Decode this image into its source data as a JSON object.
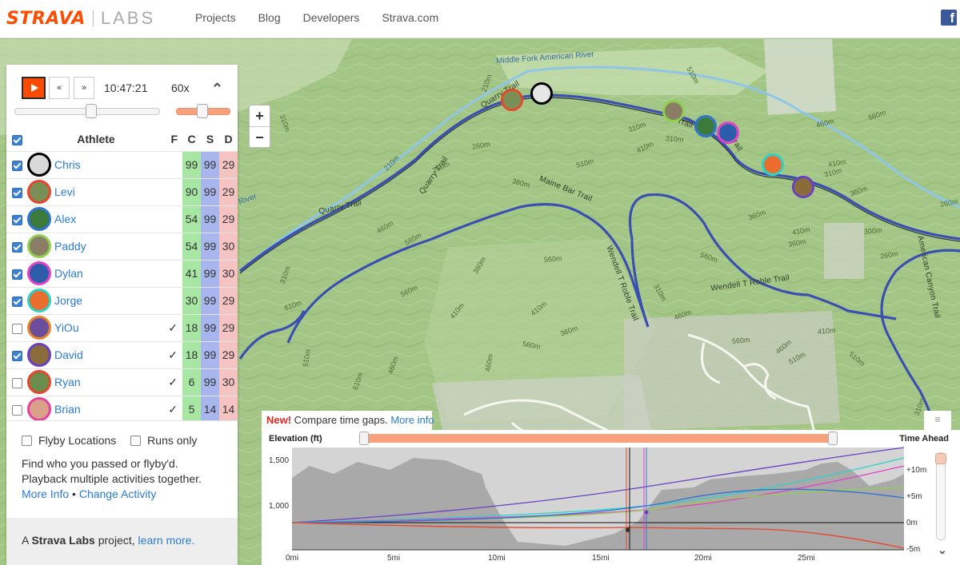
{
  "header": {
    "logo_main": "STRAVA",
    "logo_sub": "LABS",
    "nav": [
      "Projects",
      "Blog",
      "Developers",
      "Strava.com"
    ],
    "facebook_icon": "facebook-icon"
  },
  "map": {
    "zoom_in": "+",
    "zoom_out": "−",
    "labels": {
      "river_top": "Middle Fork American River",
      "river_left": "River",
      "quarry_top": "Quarry Trail",
      "quarry_side": "Quarry Trail",
      "quarry_mid": "Quarry Trail",
      "maine_bar": "Maine Bar Trail",
      "wendell_vert": "Wendell T Roble Trail",
      "wendell_horiz": "Wendell T Roble Trail",
      "american_canyon": "American Canyon Trail",
      "trail_frag_1": "Trail",
      "trail_frag_2": "Trail"
    },
    "contours": [
      "210m",
      "210m",
      "310m",
      "260m",
      "360m",
      "260m",
      "310m",
      "410m",
      "310m",
      "510m",
      "460m",
      "410m",
      "360m",
      "310m",
      "300m",
      "260m",
      "410m",
      "560m",
      "510m",
      "460m",
      "560m",
      "360m",
      "410m",
      "310m",
      "510m",
      "610m",
      "460m",
      "610m",
      "560m",
      "410m",
      "360m",
      "460m",
      "310m",
      "560m",
      "460m",
      "360m",
      "410m",
      "510m",
      "510m",
      "560m",
      "460m",
      "360m",
      "560m",
      "560m",
      "310m",
      "260m"
    ]
  },
  "controls": {
    "play_icon": "play-icon",
    "rewind_label": "«",
    "forward_label": "»",
    "time": "10:47:21",
    "speed": "60x",
    "collapse_icon": "chevron-up-icon"
  },
  "table": {
    "headers": {
      "athlete": "Athlete",
      "f": "F",
      "c": "C",
      "s": "S",
      "d": "D"
    },
    "rows": [
      {
        "name": "Chris",
        "checked": true,
        "f": "",
        "c": "99",
        "s": "99",
        "d": "29",
        "ring": "#000000",
        "fill": "#d9d9d9"
      },
      {
        "name": "Levi",
        "checked": true,
        "f": "",
        "c": "90",
        "s": "99",
        "d": "29",
        "ring": "#e8452b",
        "fill": "#7a8f55"
      },
      {
        "name": "Alex",
        "checked": true,
        "f": "",
        "c": "54",
        "s": "99",
        "d": "29",
        "ring": "#2f74d0",
        "fill": "#3b7a3a"
      },
      {
        "name": "Paddy",
        "checked": true,
        "f": "",
        "c": "54",
        "s": "99",
        "d": "30",
        "ring": "#8fd14f",
        "fill": "#8a7d66"
      },
      {
        "name": "Dylan",
        "checked": true,
        "f": "",
        "c": "41",
        "s": "99",
        "d": "30",
        "ring": "#e342c8",
        "fill": "#2c5da8"
      },
      {
        "name": "Jorge",
        "checked": true,
        "f": "",
        "c": "30",
        "s": "99",
        "d": "29",
        "ring": "#2ad3c8",
        "fill": "#e96d2c"
      },
      {
        "name": "YiOu",
        "checked": false,
        "f": "✓",
        "c": "18",
        "s": "99",
        "d": "29",
        "ring": "#e8842b",
        "fill": "#6a4e9c"
      },
      {
        "name": "David",
        "checked": true,
        "f": "✓",
        "c": "18",
        "s": "99",
        "d": "29",
        "ring": "#6a3fc4",
        "fill": "#8a6b3a"
      },
      {
        "name": "Ryan",
        "checked": false,
        "f": "✓",
        "c": "6",
        "s": "99",
        "d": "30",
        "ring": "#e8452b",
        "fill": "#6b8c4d"
      },
      {
        "name": "Brian",
        "checked": false,
        "f": "✓",
        "c": "5",
        "s": "14",
        "d": "14",
        "ring": "#e342a0",
        "fill": "#d9a08a"
      }
    ]
  },
  "options": {
    "flyby_label": "Flyby Locations",
    "runs_only_label": "Runs only",
    "desc_line1": "Find who you passed or flyby'd.",
    "desc_line2": "Playback multiple activities together.",
    "more_info": "More Info",
    "separator": " • ",
    "change_activity": "Change Activity"
  },
  "footer": {
    "prefix": "A ",
    "brand": "Strava Labs",
    "middle": " project, ",
    "link": "learn more."
  },
  "elevation": {
    "new_tag": "New!",
    "banner_text": " Compare time gaps. ",
    "banner_link": "More info",
    "title": "Elevation (ft)",
    "right_title": "Time Ahead",
    "y_ticks": [
      "1,500",
      "1,000"
    ],
    "x_ticks": [
      "0mi",
      "5mi",
      "10mi",
      "15mi",
      "20mi",
      "25mi"
    ],
    "right_ticks": [
      "+10m",
      "+5m",
      "0m",
      "-5m"
    ],
    "menu_icon": "menu-icon",
    "chevron_icon": "chevron-down-icon"
  }
}
